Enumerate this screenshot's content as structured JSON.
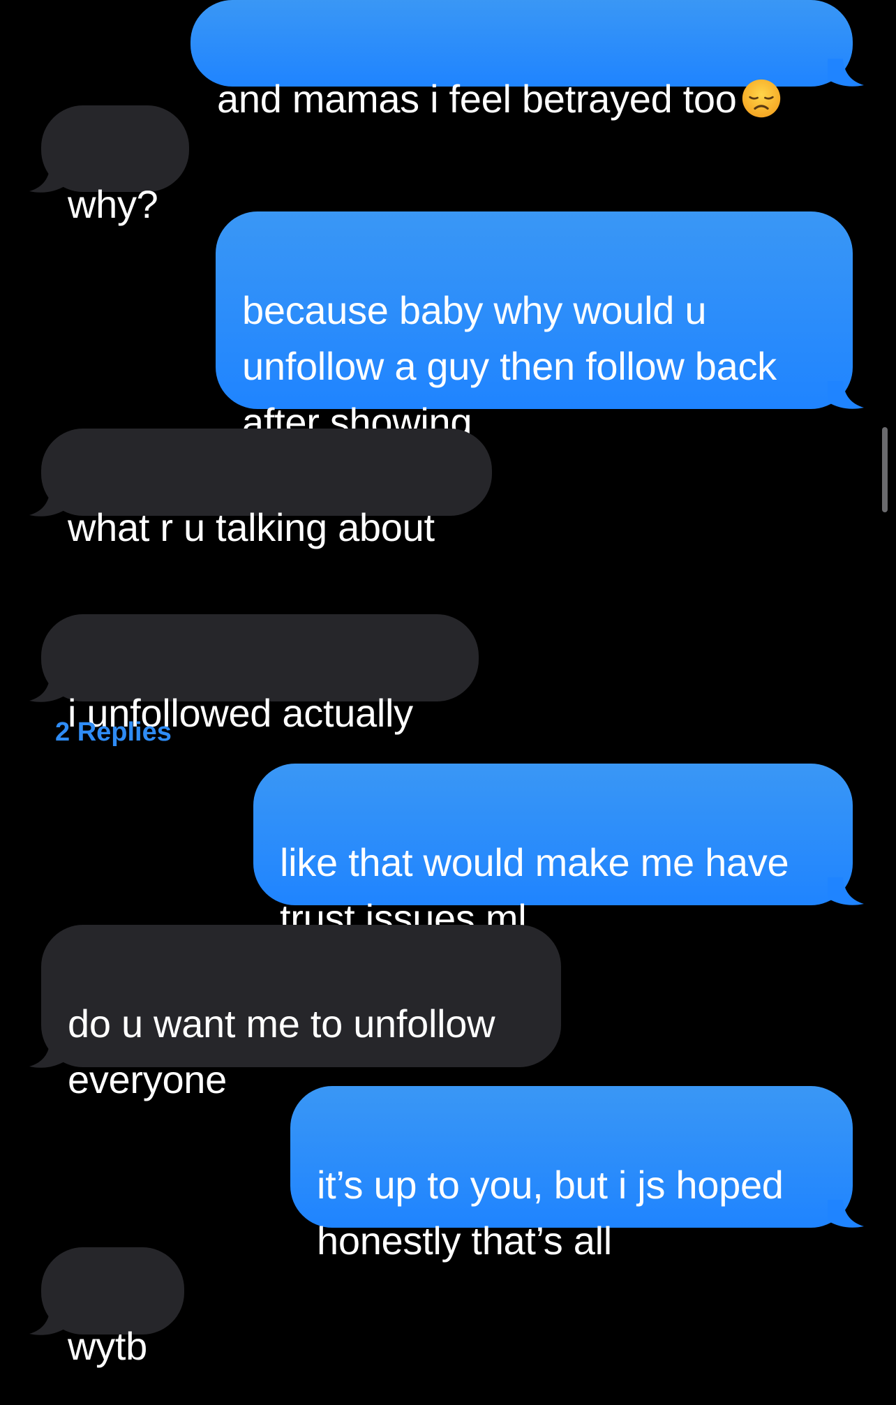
{
  "messages": [
    {
      "direction": "sent",
      "text": "and mamas i feel betrayed too",
      "emoji": "disappointed-face-icon"
    },
    {
      "direction": "received",
      "text": "why?"
    },
    {
      "direction": "sent",
      "text": "because baby why would u\nunfollow a guy then follow back\nafter showing"
    },
    {
      "direction": "received",
      "text": "what r u talking about"
    },
    {
      "direction": "received",
      "text": "i unfollowed actually",
      "replies_label": "2 Replies"
    },
    {
      "direction": "sent",
      "text": "like that would make me have\ntrust issues ml"
    },
    {
      "direction": "received",
      "text": "do u want me to unfollow\neveryone"
    },
    {
      "direction": "sent",
      "text": "it’s up to you, but i js hoped\nhonestly that’s all"
    },
    {
      "direction": "received",
      "text": "wytb"
    }
  ],
  "colors": {
    "background": "#000000",
    "sent_bubble": "#1f84ff",
    "received_bubble": "#26262a",
    "replies_link": "#2f8cf5",
    "text": "#ffffff"
  }
}
